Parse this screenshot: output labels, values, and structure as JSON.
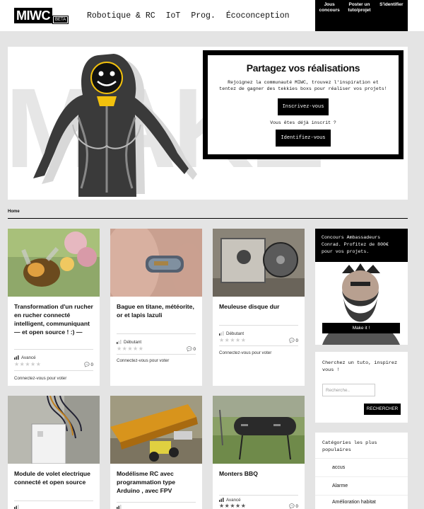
{
  "header": {
    "logo": "MIWC",
    "logo_badge": "BETA",
    "nav": [
      "Robotique & RC",
      "IoT",
      "Prog.",
      "Écoconception"
    ],
    "user_menu": {
      "my_contests": "Jous concours",
      "post_tuto": "Poster un tuto/projet",
      "login": "S'identifier"
    }
  },
  "hero": {
    "bg_word": "MAKE",
    "title": "Partagez vos réalisations",
    "text": "Rejoignez la communauté MIWC, trouvez l'inspiration et tentez de gagner des tekkies boxs pour réaliser vos projets!",
    "signup_button": "Inscrivez-vous",
    "already_member": "Vous êtes déjà inscrit ?",
    "login_button": "Identifiez-vous"
  },
  "breadcrumb": "Home",
  "cards": [
    {
      "title": "Transformation d'un rucher en rucher connecté intelligent, communiquant — et open source ! :) —",
      "level": "Avancé",
      "comments": "0",
      "login_prompt": "Connectez-vous pour voter",
      "image": "bee-on-flowers"
    },
    {
      "title": "Bague en titane, météorite, or et lapis lazuli",
      "level": "Débutant",
      "comments": "0",
      "login_prompt": "Connectez-vous pour voter",
      "image": "titanium-ring"
    },
    {
      "title": "Meuleuse disque dur",
      "level": "Débutant",
      "comments": "0",
      "login_prompt": "Connectez-vous pour voter",
      "image": "hard-disk-grinder"
    },
    {
      "title": "Module de volet electrique connecté et open source",
      "level": "",
      "comments": "",
      "login_prompt": "",
      "image": "shutter-module"
    },
    {
      "title": "Modélisme RC avec programmation type Arduino , avec FPV",
      "level": "",
      "comments": "",
      "login_prompt": "",
      "image": "rc-truck"
    },
    {
      "title": "Monters BBQ",
      "level": "Avancé",
      "comments": "0",
      "login_prompt": "",
      "image": "bbq-barrel"
    }
  ],
  "sidebar": {
    "promo_text": "Concours Ambassadeurs Conrad. Profitez de 800€ pour vos projets.",
    "promo_button": "Make it !",
    "search_title": "Cherchez un tuto, inspirez vous !",
    "search_placeholder": "Recherche..",
    "search_button": "RECHERCHER",
    "categories_title": "Catégories les plus populaires",
    "categories": [
      "accus",
      "Alarme",
      "Amélioration habitat"
    ]
  },
  "colors": {
    "accent": "#000000",
    "background": "#e4e4e4",
    "card": "#ffffff"
  }
}
